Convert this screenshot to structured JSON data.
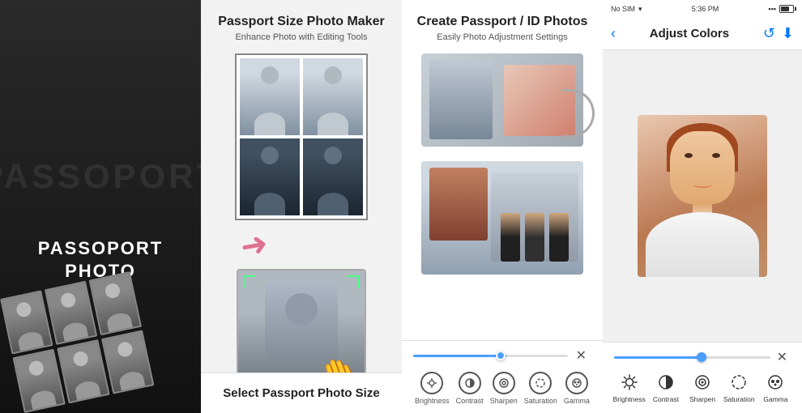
{
  "panel1": {
    "overlay_text": "PASSOPORT",
    "title_line1": "PASSOPORT",
    "title_line2": "PHOTO"
  },
  "panel2": {
    "title": "Passport Size Photo Maker",
    "subtitle": "Enhance Photo with Editing Tools",
    "footer_label": "Select Passport Photo Size"
  },
  "panel3": {
    "title": "Create Passport / ID Photos",
    "subtitle": "Easily Photo Adjustment Settings"
  },
  "panel4": {
    "status_bar": {
      "carrier": "No SIM",
      "time": "5:36 PM"
    },
    "nav": {
      "back_icon": "‹",
      "title": "Adjust Colors",
      "history_icon": "↺",
      "save_icon": "⬇"
    },
    "toolbar": {
      "close_icon": "✕",
      "icons": [
        {
          "label": "Brightness",
          "icon": "brightness"
        },
        {
          "label": "Contrast",
          "icon": "contrast"
        },
        {
          "label": "Sharpen",
          "icon": "sharpen"
        },
        {
          "label": "Saturation",
          "icon": "saturation"
        },
        {
          "label": "Gamma",
          "icon": "gamma"
        }
      ]
    }
  },
  "shared_toolbar": {
    "close_icon": "✕",
    "icons": [
      {
        "label": "Brightness"
      },
      {
        "label": "Contrast"
      },
      {
        "label": "Sharpen"
      },
      {
        "label": "Saturation"
      },
      {
        "label": "Gamma"
      }
    ]
  }
}
